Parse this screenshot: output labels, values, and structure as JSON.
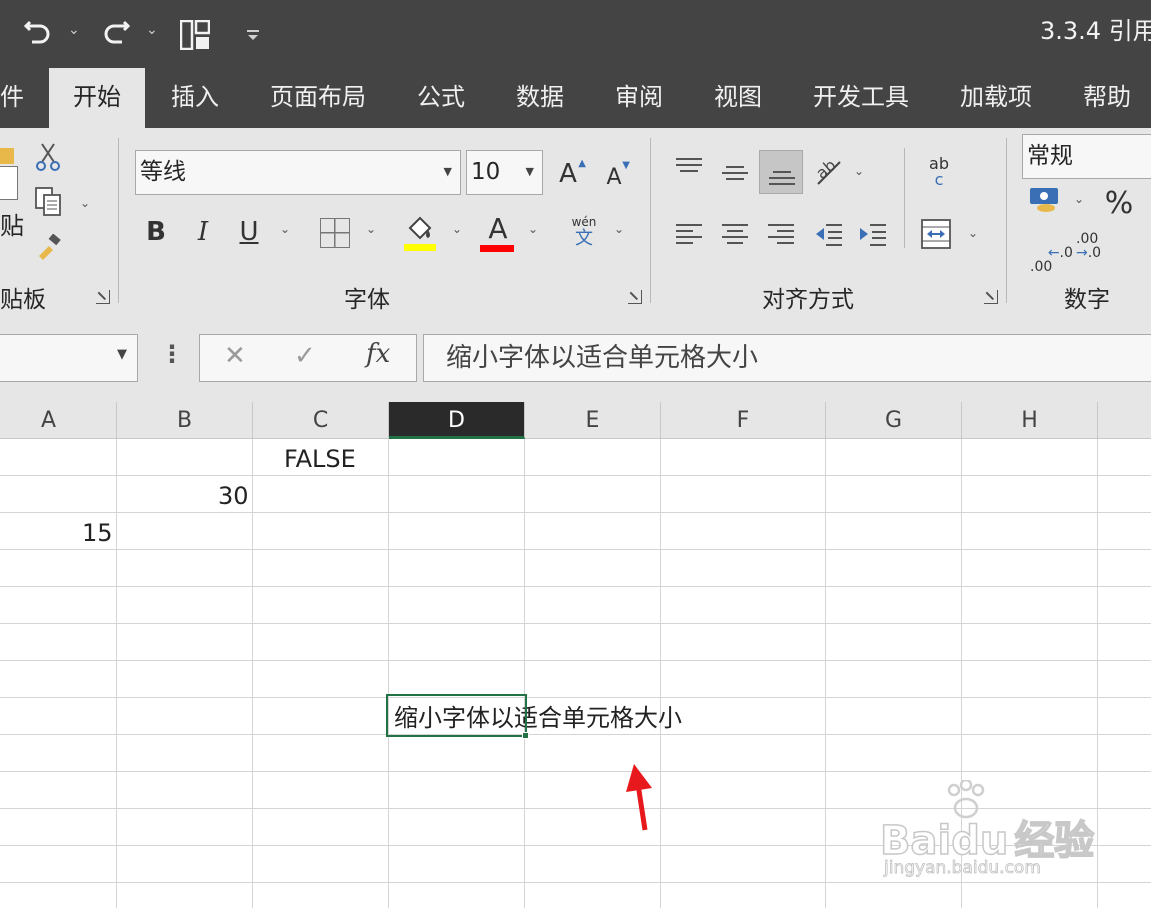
{
  "title_bar": {
    "undo_icon": "undo-icon",
    "redo_icon": "redo-icon",
    "layout_icon": "layout-icon",
    "customize_icon": "customize-qat-icon",
    "doc_title": "3.3.4 引用"
  },
  "tabs": [
    {
      "label": "件",
      "active": false
    },
    {
      "label": "开始",
      "active": true
    },
    {
      "label": "插入",
      "active": false
    },
    {
      "label": "页面布局",
      "active": false
    },
    {
      "label": "公式",
      "active": false
    },
    {
      "label": "数据",
      "active": false
    },
    {
      "label": "审阅",
      "active": false
    },
    {
      "label": "视图",
      "active": false
    },
    {
      "label": "开发工具",
      "active": false
    },
    {
      "label": "加载项",
      "active": false
    },
    {
      "label": "帮助",
      "active": false
    }
  ],
  "ribbon": {
    "clipboard": {
      "label": "贴板",
      "paste_label": "贴"
    },
    "font": {
      "label": "字体",
      "font_name": "等线",
      "font_size": "10",
      "bold": "B",
      "italic": "I",
      "underline": "U",
      "grow": "A",
      "shrink": "A",
      "font_color": "A",
      "phonetic_top": "wén",
      "phonetic_bottom": "文",
      "fill_color": "#ffff00",
      "font_color_value": "#ff0000"
    },
    "alignment": {
      "label": "对齐方式",
      "wrap_top": "ab",
      "wrap_bottom": "c"
    },
    "number": {
      "label": "数字",
      "format": "常规",
      "percent": "%",
      "inc_decimal": ".0\n.00",
      "dec_decimal": ".00\n.0"
    }
  },
  "formula_bar": {
    "fx": "fx",
    "cancel": "✕",
    "enter": "✓",
    "more": "⋮",
    "content": "缩小字体以适合单元格大小"
  },
  "grid": {
    "columns": [
      "A",
      "B",
      "C",
      "D",
      "E",
      "F",
      "G",
      "H"
    ],
    "selected_column": "D",
    "cells": {
      "C1": "FALSE",
      "B2": "30",
      "A3": "15",
      "D8": "缩小字体以适合单元格大小"
    }
  },
  "annotation": {
    "arrow_color": "#e8191c"
  },
  "watermark": {
    "brand": "Bai",
    "brand2": "du",
    "cn": "经验",
    "url": "jingyan.baidu.com"
  }
}
